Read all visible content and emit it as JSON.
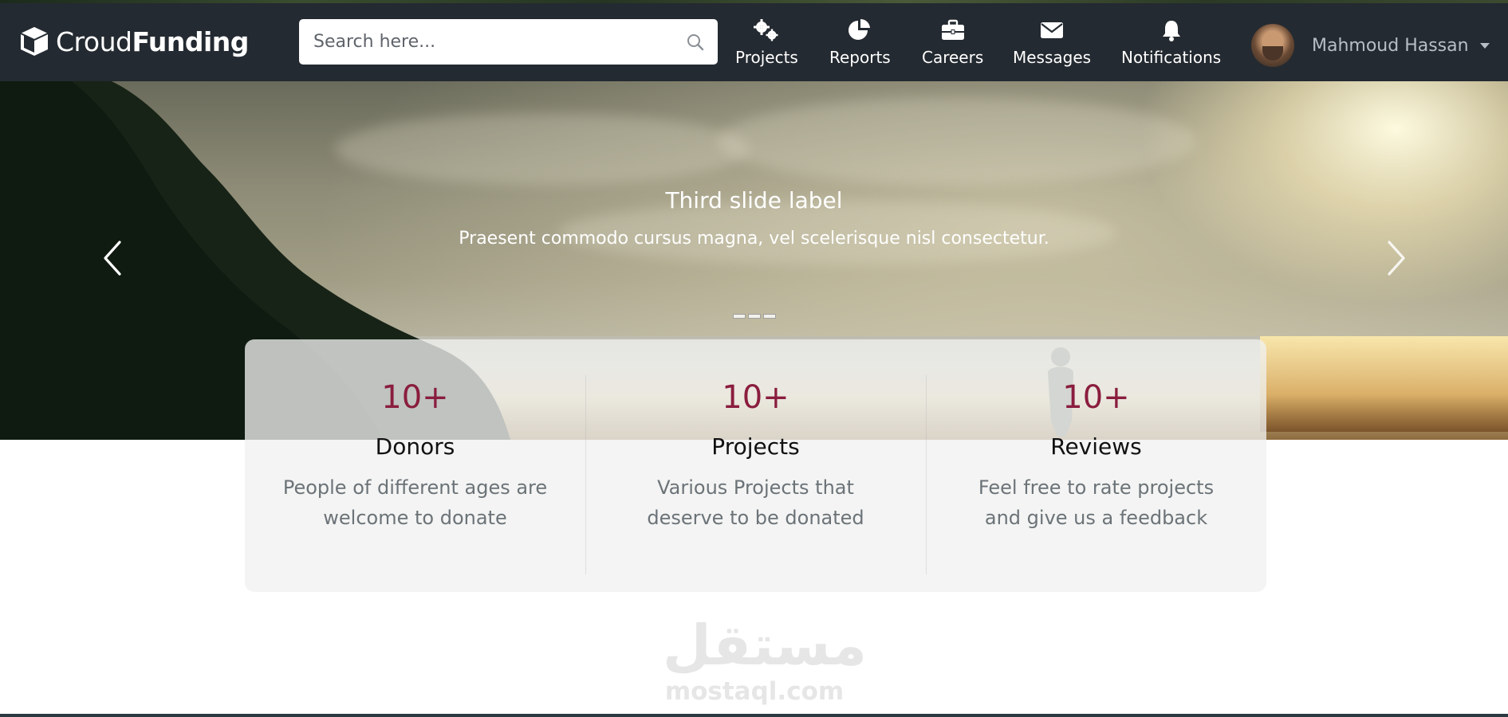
{
  "brand": {
    "part1": "Croud",
    "part2": "Funding",
    "icon": "cube-icon"
  },
  "search": {
    "placeholder": "Search here...",
    "icon": "search-icon"
  },
  "nav": [
    {
      "label": "Projects",
      "icon": "cogs-icon"
    },
    {
      "label": "Reports",
      "icon": "pie-chart-icon"
    },
    {
      "label": "Careers",
      "icon": "briefcase-icon"
    },
    {
      "label": "Messages",
      "icon": "envelope-icon"
    },
    {
      "label": "Notifications",
      "icon": "bell-icon"
    }
  ],
  "user": {
    "name": "Mahmoud Hassan",
    "icon": "caret-down-icon"
  },
  "carousel": {
    "title": "Third slide label",
    "text": "Praesent commodo cursus magna, vel scelerisque nisl consectetur.",
    "prev_icon": "chevron-left-icon",
    "next_icon": "chevron-right-icon",
    "indicator_count": 3
  },
  "stats": [
    {
      "number": "10+",
      "title": "Donors",
      "description": "People of different ages are welcome to donate"
    },
    {
      "number": "10+",
      "title": "Projects",
      "description": "Various Projects that deserve to be donated"
    },
    {
      "number": "10+",
      "title": "Reviews",
      "description": "Feel free to rate projects and give us a feedback"
    }
  ],
  "watermark": {
    "arabic": "مستقل",
    "latin": "mostaql.com"
  },
  "colors": {
    "navbar": "#242a31",
    "accent_number": "#8a1d3e",
    "muted_text": "#6c7378"
  }
}
